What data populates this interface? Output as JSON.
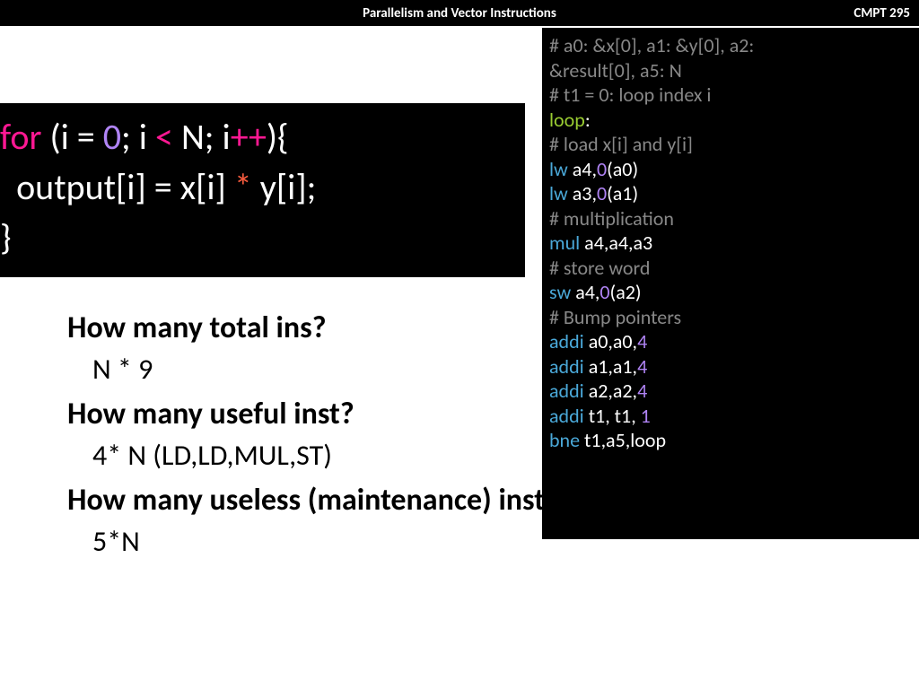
{
  "header": {
    "title": "Parallelism and Vector Instructions",
    "course": "CMPT 295"
  },
  "ccode": {
    "for": "for",
    "open": " (i = ",
    "zero": "0",
    "semi1": "; i ",
    "lt": "<",
    "nsemi": " N; i",
    "pp": "++",
    "close": "){",
    "line2a": "  output[i] = x[i] ",
    "star": "*",
    "line2b": " y[i];",
    "line3": "}"
  },
  "asm": {
    "c1": "# a0: &x[0], a1: &y[0], a2:",
    "c1b": "&result[0], a5: N",
    "c2": "# t1 = 0: loop index i",
    "label": "loop",
    "colon": ":",
    "c3": "# load x[i] and y[i]",
    "lw1_op": "lw",
    "lw1_args": " a4,",
    "lw1_imm": "0",
    "lw1_tail": "(a0)",
    "lw2_op": "lw",
    "lw2_args": " a3,",
    "lw2_imm": "0",
    "lw2_tail": "(a1)",
    "c4": "# multiplication",
    "mul_op": "mul",
    "mul_args": " a4,a4,a3",
    "c5": "# store word",
    "sw_op": "sw",
    "sw_args": " a4,",
    "sw_imm": "0",
    "sw_tail": "(a2)",
    "c6": "# Bump pointers",
    "ad1_op": "addi",
    "ad1_args": " a0,a0,",
    "ad1_imm": "4",
    "ad2_op": "addi",
    "ad2_args": " a1,a1,",
    "ad2_imm": "4",
    "ad3_op": "addi",
    "ad3_args": " a2,a2,",
    "ad3_imm": "4",
    "ad4_op": "addi",
    "ad4_args": " t1, t1, ",
    "ad4_imm": "1",
    "bne_op": "bne",
    "bne_args": " t1,a5,loop"
  },
  "qa": {
    "q1": "How many total ins?",
    "a1": "N * 9",
    "q2": "How many useful inst?",
    "a2": "4* N (LD,LD,MUL,ST)",
    "q3": "How many useless (maintenance) inst?",
    "a3": "5*N"
  }
}
